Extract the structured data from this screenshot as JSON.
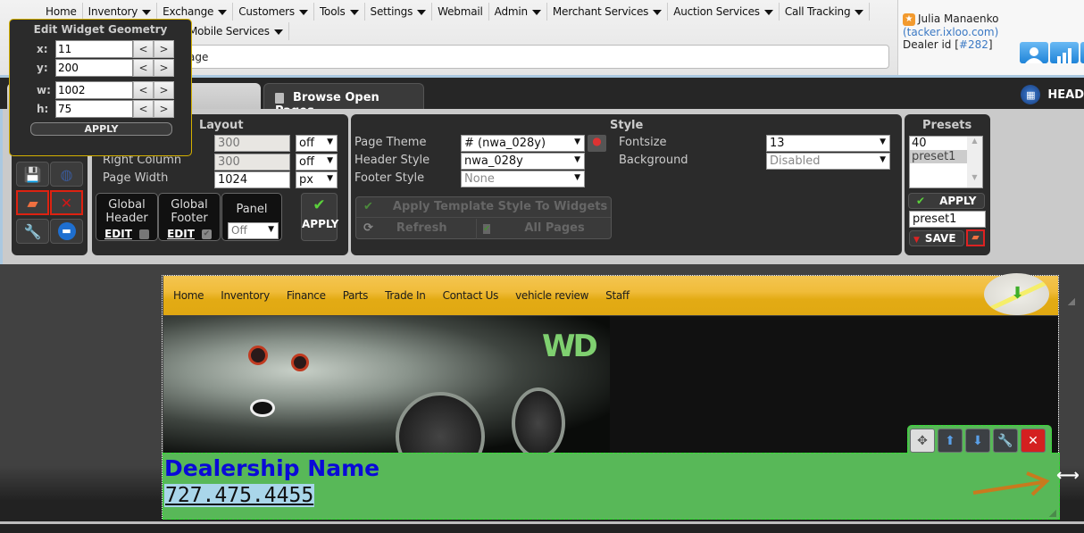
{
  "nav": {
    "row1": [
      {
        "label": "Home",
        "dropdown": false
      },
      {
        "label": "Inventory",
        "dropdown": true
      },
      {
        "label": "Exchange",
        "dropdown": true
      },
      {
        "label": "Customers",
        "dropdown": true
      },
      {
        "label": "Tools",
        "dropdown": true
      },
      {
        "label": "Settings",
        "dropdown": true
      },
      {
        "label": "Webmail",
        "dropdown": false
      },
      {
        "label": "Admin",
        "dropdown": true
      },
      {
        "label": "Merchant Services",
        "dropdown": true
      },
      {
        "label": "Auction Services",
        "dropdown": true
      },
      {
        "label": "Call Tracking",
        "dropdown": true
      }
    ],
    "row2": [
      {
        "label": "Mobile Services",
        "dropdown": true
      }
    ]
  },
  "url_field": {
    "value": "age"
  },
  "user": {
    "name": "Julia Manaenko",
    "domain": "(tacker.ixloo.com)",
    "dealer_label": "Dealer id",
    "dealer_id": "#282",
    "icons": [
      "user-icon",
      "stats-icon"
    ]
  },
  "tabs": {
    "tab1": "",
    "tab2": "Browse Open Pages",
    "right_label": "HEAD"
  },
  "geometry": {
    "title": "Edit Widget Geometry",
    "fields": [
      {
        "label": "x:",
        "value": "11"
      },
      {
        "label": "y:",
        "value": "200"
      },
      {
        "label": "w:",
        "value": "1002"
      },
      {
        "label": "h:",
        "value": "75"
      }
    ],
    "dec": "<",
    "inc": ">",
    "apply": "APPLY"
  },
  "layout": {
    "title": "Layout",
    "rows": [
      {
        "label": "",
        "value": "300",
        "unit": "off"
      },
      {
        "label": "Right Column",
        "value": "300",
        "unit": "off"
      },
      {
        "label": "Page Width",
        "value": "1024",
        "unit": "px"
      }
    ],
    "global_header": {
      "line1": "Global",
      "line2": "Header",
      "edit": "EDIT"
    },
    "global_footer": {
      "line1": "Global",
      "line2": "Footer",
      "edit": "EDIT"
    },
    "panel": {
      "label": "Panel",
      "value": "Off"
    },
    "apply": "APPLY"
  },
  "style": {
    "title": "Style",
    "page_theme": {
      "label": "Page Theme",
      "value": "# (nwa_028y)"
    },
    "header_style": {
      "label": "Header Style",
      "value": "nwa_028y"
    },
    "footer_style": {
      "label": "Footer Style",
      "value": "None"
    },
    "fontsize": {
      "label": "Fontsize",
      "value": "13"
    },
    "background": {
      "label": "Background",
      "value": "Disabled"
    },
    "apply_template": "Apply Template Style To Widgets",
    "refresh": "Refresh",
    "all_pages": "All Pages"
  },
  "presets": {
    "title": "Presets",
    "items": [
      "40",
      "preset1"
    ],
    "selected": "preset1",
    "apply": "APPLY",
    "name_value": "preset1",
    "save": "SAVE"
  },
  "site": {
    "nav": [
      "Home",
      "Inventory",
      "Finance",
      "Parts",
      "Trade In",
      "Contact Us",
      "vehicle review",
      "Staff"
    ],
    "logo_text": "WD",
    "dealership_name": "Dealership Name",
    "phone": "727.475.4455"
  },
  "colors": {
    "widget_bg": "#58b858",
    "dealer_name": "#0a0ad8",
    "nav_bar": "#f0bc3a",
    "link": "#3b79c4"
  }
}
